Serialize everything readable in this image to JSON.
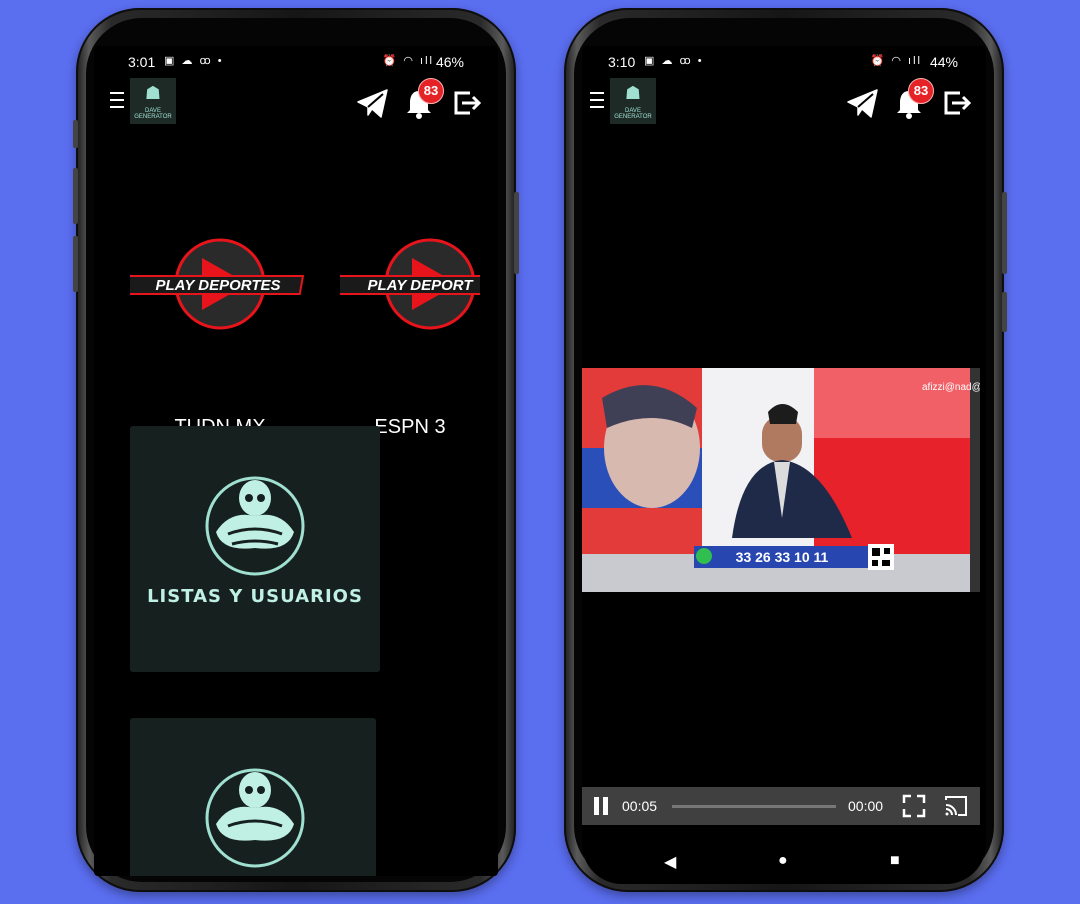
{
  "left_phone": {
    "status": {
      "time": "3:01",
      "battery": "46%",
      "left_icons": "▣ ☁ ꝏ •",
      "right_icons": "⏰ ◠ ıll"
    },
    "app": {
      "logo_text": "DAVE GENERATOR",
      "notification_count": "83"
    },
    "channels": [
      {
        "logo_text": "PLAY DEPORTES",
        "name": "TUDN MX"
      },
      {
        "logo_text": "PLAY DEPORT",
        "name": "ESPN 3"
      }
    ],
    "tiles": [
      {
        "title": "LISTAS Y USUARIOS"
      },
      {
        "title": ""
      }
    ]
  },
  "right_phone": {
    "status": {
      "time": "3:10",
      "battery": "44%",
      "left_icons": "▣ ☁ ꝏ •",
      "right_icons": "⏰ ◠ ıll"
    },
    "app": {
      "logo_text": "DAVE GENERATOR",
      "notification_count": "83"
    },
    "video": {
      "watermark": "afizzi@nad@s",
      "phone_number": "33 26 33 10 11"
    },
    "player": {
      "elapsed": "00:05",
      "remaining": "00:00",
      "progress": 0.0
    }
  },
  "colors": {
    "background": "#5a6ef0",
    "badge": "#e52226",
    "play_red": "#e8141c"
  }
}
